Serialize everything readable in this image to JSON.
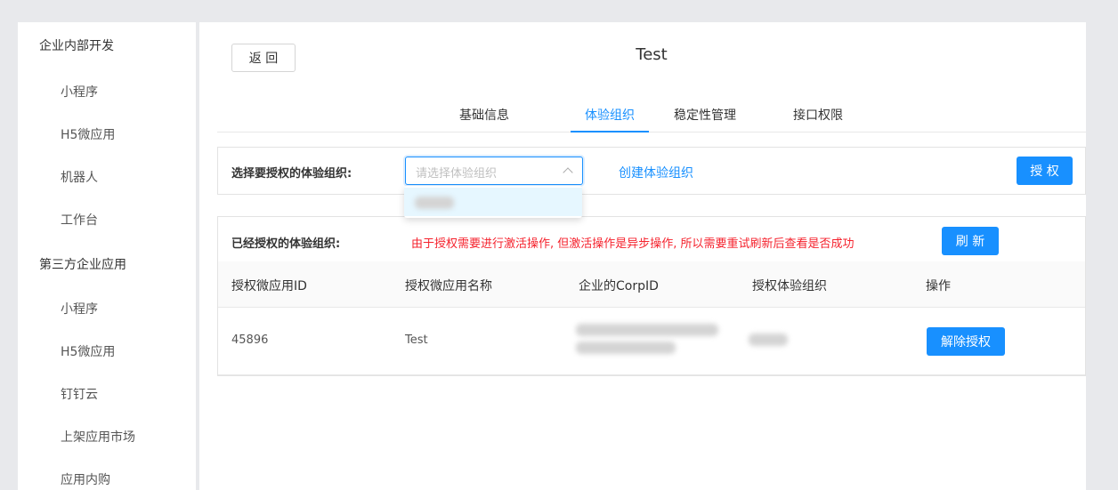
{
  "sidebar": {
    "groups": [
      {
        "title": "企业内部开发",
        "items": [
          "小程序",
          "H5微应用",
          "机器人",
          "工作台"
        ]
      },
      {
        "title": "第三方企业应用",
        "items": [
          "小程序",
          "H5微应用",
          "钉钉云",
          "上架应用市场",
          "应用内购"
        ]
      }
    ]
  },
  "header": {
    "back_label": "返 回",
    "title": "Test"
  },
  "tabs": [
    {
      "label": "基础信息",
      "active": false
    },
    {
      "label": "体验组织",
      "active": true
    },
    {
      "label": "稳定性管理",
      "active": false
    },
    {
      "label": "接口权限",
      "active": false
    }
  ],
  "authorize_panel": {
    "label": "选择要授权的体验组织:",
    "select_placeholder": "请选择体验组织",
    "create_link": "创建体验组织",
    "authorize_button": "授 权"
  },
  "authorized_panel": {
    "label": "已经授权的体验组织:",
    "warning": "由于授权需要进行激活操作, 但激活操作是异步操作, 所以需要重试刷新后查看是否成功",
    "refresh_button": "刷 新",
    "columns": [
      "授权微应用ID",
      "授权微应用名称",
      "企业的CorpID",
      "授权体验组织",
      "操作"
    ],
    "rows": [
      {
        "app_id": "45896",
        "app_name": "Test",
        "action": "解除授权"
      }
    ]
  },
  "colors": {
    "accent": "#1890ff",
    "warning": "#f5222d",
    "background": "#e8e9ec"
  }
}
